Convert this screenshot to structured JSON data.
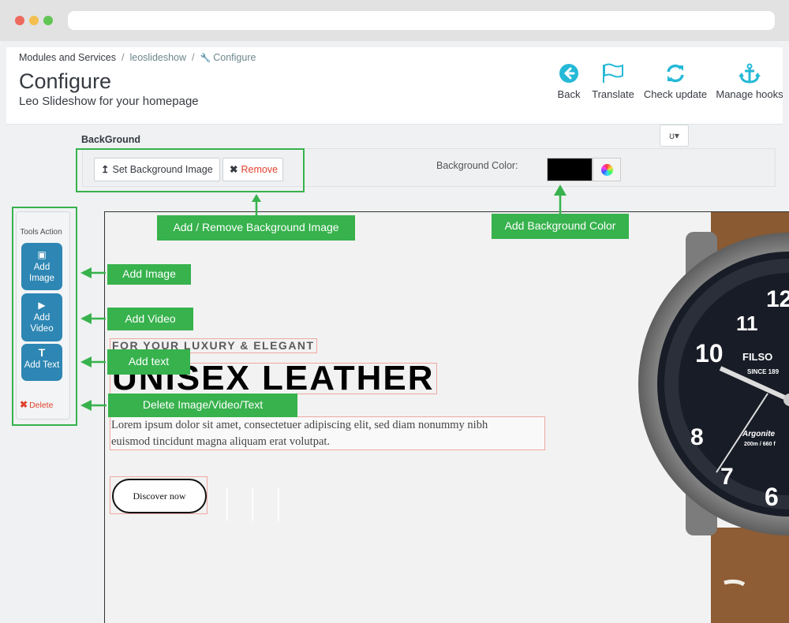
{
  "breadcrumb": {
    "items": [
      "Modules and Services",
      "leoslideshow",
      "Configure"
    ],
    "separator": "/"
  },
  "page": {
    "title": "Configure",
    "subtitle": "Leo Slideshow for your homepage"
  },
  "toolbar": {
    "back": "Back",
    "translate": "Translate",
    "check_update": "Check update",
    "manage_hooks": "Manage hooks"
  },
  "background": {
    "heading": "BackGround",
    "set_image": "Set Background Image",
    "remove": "Remove",
    "color_label": "Background Color:",
    "color_value": "#000000",
    "dropdown": "ʊ▾"
  },
  "annotations": {
    "add_remove_bg": "Add / Remove Background Image",
    "add_bg_color": "Add Background Color",
    "add_image": "Add Image",
    "add_video": "Add Video",
    "add_text": "Add text",
    "delete": "Delete Image/Video/Text"
  },
  "tools_action": {
    "title": "Tools Action",
    "add_image": [
      "Add",
      "Image"
    ],
    "add_video": [
      "Add",
      "Video"
    ],
    "add_text": "Add Text",
    "delete": "Delete"
  },
  "slide": {
    "subtitle": "FOR YOUR LUXURY & ELEGANT",
    "title": "UNISEX LEATHER",
    "description_line1": "Lorem ipsum dolor sit amet, consectetuer adipiscing elit, sed diam nonummy nibh",
    "description_line2": "euismod tincidunt magna aliquam erat volutpat.",
    "button": "Discover now",
    "watch_brand": "FILSO",
    "watch_since": "SINCE 189",
    "watch_model": "Argonite",
    "watch_depth": "200m / 660 f"
  },
  "colors": {
    "accent_green": "#37b24d",
    "button_blue": "#2d86b3",
    "toolbar_icon": "#25b9d7",
    "delete_red": "#e0422e"
  }
}
